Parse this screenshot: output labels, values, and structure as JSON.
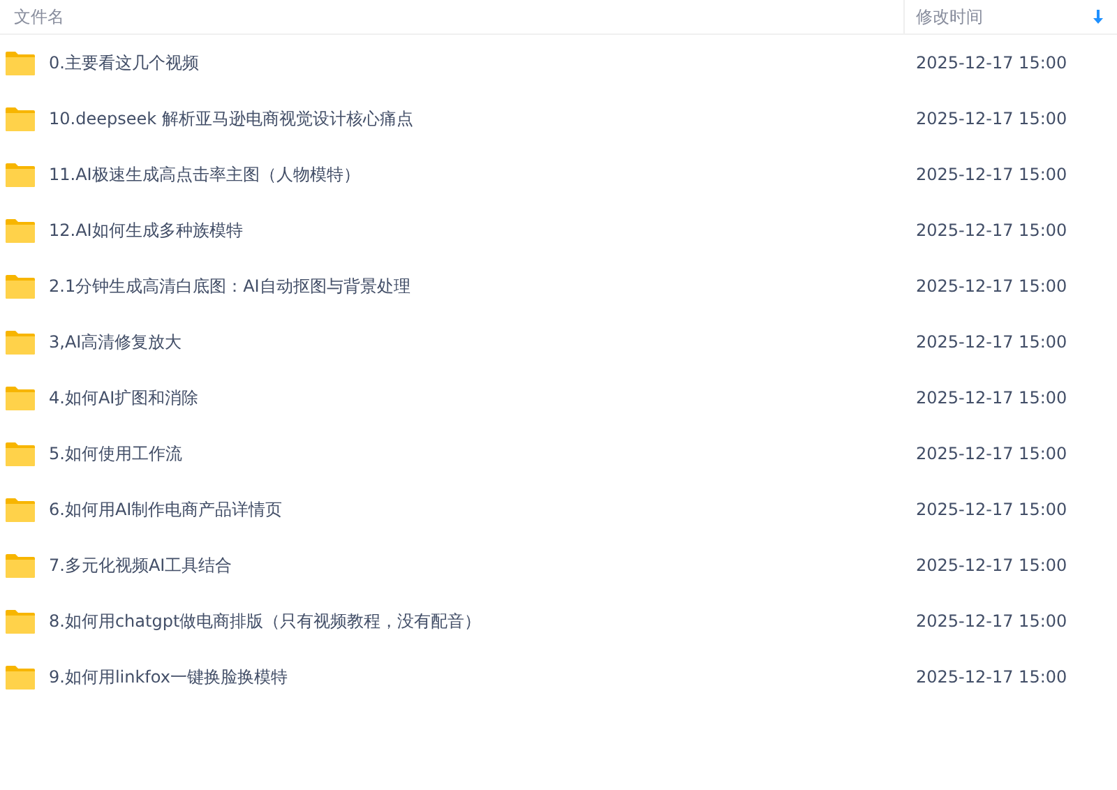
{
  "columns": [
    {
      "label": "文件名",
      "sorted": false
    },
    {
      "label": "修改时间",
      "sorted": true
    }
  ],
  "rows": [
    {
      "name": "0.主要看这几个视频",
      "modified": "2025-12-17 15:00"
    },
    {
      "name": "10.deepseek 解析亚马逊电商视觉设计核心痛点",
      "modified": "2025-12-17 15:00"
    },
    {
      "name": "11.AI极速生成高点击率主图（人物模特）",
      "modified": "2025-12-17 15:00"
    },
    {
      "name": "12.AI如何生成多种族模特",
      "modified": "2025-12-17 15:00"
    },
    {
      "name": "2.1分钟生成高清白底图：AI自动抠图与背景处理",
      "modified": "2025-12-17 15:00"
    },
    {
      "name": "3,AI高清修复放大",
      "modified": "2025-12-17 15:00"
    },
    {
      "name": "4.如何AI扩图和消除",
      "modified": "2025-12-17 15:00"
    },
    {
      "name": "5.如何使用工作流",
      "modified": "2025-12-17 15:00"
    },
    {
      "name": "6.如何用AI制作电商产品详情页",
      "modified": "2025-12-17 15:00"
    },
    {
      "name": "7.多元化视频AI工具结合",
      "modified": "2025-12-17 15:00"
    },
    {
      "name": "8.如何用chatgpt做电商排版（只有视频教程，没有配音）",
      "modified": "2025-12-17 15:00"
    },
    {
      "name": "9.如何用linkfox一键换脸换模特",
      "modified": "2025-12-17 15:00"
    }
  ]
}
